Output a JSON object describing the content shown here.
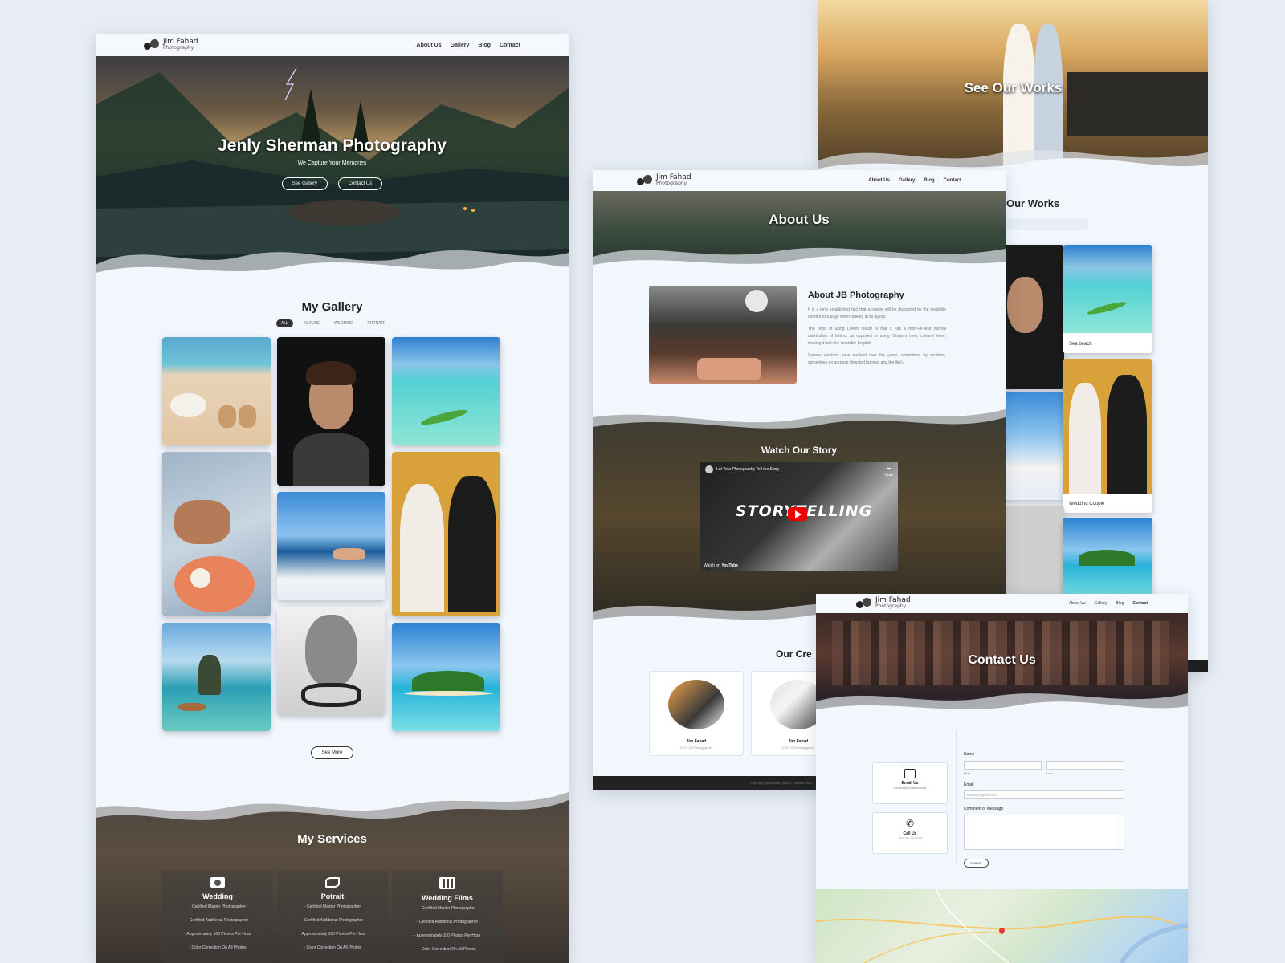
{
  "brand": {
    "name": "Jim Fahad",
    "tagline": "Photography"
  },
  "nav": {
    "about": "About Us",
    "gallery": "Gallery",
    "blog": "Blog",
    "contact": "Contact"
  },
  "home": {
    "hero_title": "Jenly Sherman Photography",
    "hero_subtitle": "We Capture Your Memories",
    "btn_gallery": "See Gallery",
    "btn_contact": "Contact Us",
    "gallery_title": "My Gallery",
    "filters": [
      "ALL",
      "NATURE",
      "WEDDING",
      "POTRAIT"
    ],
    "see_more": "See More",
    "services_title": "My Services",
    "services": [
      {
        "title": "Wedding",
        "icon": "camera-icon",
        "items": [
          "- Certified Master Photographer",
          "- Certified Additional Photographer",
          "- Approximately 100 Photos Per Hour",
          "- Color Correction On All Photos"
        ]
      },
      {
        "title": "Potrait",
        "icon": "portrait-icon",
        "items": [
          "- Certified Master Photographer",
          "- Certified Additional Photographer",
          "- Approximately 100 Photos Per Hour",
          "- Color Correction On All Photos"
        ]
      },
      {
        "title": "Wedding Films",
        "icon": "film-icon",
        "items": [
          "- Certified Master Photographer",
          "- Certified Additional Photographer",
          "- Approximately 100 Photos Per Hour",
          "- Color Correction On All Photos"
        ]
      }
    ]
  },
  "works": {
    "hero_title": "See Our Works",
    "section_title": "Our Works",
    "cards": [
      "Sea beach",
      "Wedding Couple"
    ]
  },
  "about": {
    "hero_title": "About Us",
    "heading": "About JB Photography",
    "paragraphs": [
      "It is a long established fact that a reader will be distracted by the readable content of a page when looking at its layout.",
      "The point of using Lorem Ipsum is that it has a more-or-less normal distribution of letters, as opposed to using 'Content here, content here', making it look like readable English.",
      "Various versions have evolved over the years, sometimes by accident, sometimes on purpose (injected humour and the like)."
    ],
    "story_title": "Watch Our Story",
    "video_title": "Let Your Photography Tell the Story",
    "video_share": "Share",
    "video_text": "STORYTELLING",
    "watch_on": "Watch on",
    "youtube": "YouTube",
    "crew_title": "Our Cre",
    "crew": [
      {
        "name": "Jim Fahad",
        "role": "CEO, Of Photographer"
      },
      {
        "name": "Jim Fahad",
        "role": "CEO, Of Photographer"
      }
    ],
    "footer": "Copyright @jimfahad_photo | Created With..."
  },
  "contact": {
    "hero_title": "Contact Us",
    "email_label": "Email Us",
    "email_value": "contact@jimfahad.com",
    "call_label": "Call Us",
    "call_value": "+54 102 10 5333",
    "name_label": "Name",
    "first": "First",
    "last": "Last",
    "email_field": "Email",
    "email_placeholder": "example@gmail.com",
    "message_label": "Comment or Message",
    "submit": "SUBMIT"
  },
  "colors": {
    "page_bg": "#e8edf5",
    "card_bg": "#f2f7fd",
    "dark": "#2b2b2b"
  }
}
